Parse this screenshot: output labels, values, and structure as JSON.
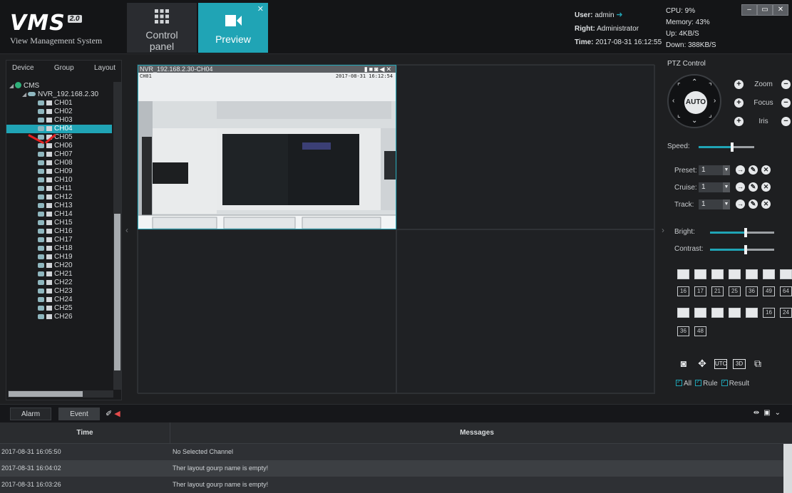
{
  "app": {
    "logo_text": "VMS",
    "version_badge": "2.0",
    "subtitle": "View Management System"
  },
  "nav_tabs": [
    {
      "label": "Control\npanel"
    },
    {
      "label": "Preview"
    }
  ],
  "user_info": {
    "user_label": "User:",
    "user_value": "admin",
    "right_label": "Right:",
    "right_value": "Administrator",
    "time_label": "Time:",
    "time_value": "2017-08-31 16:12:55"
  },
  "system_info": {
    "cpu": "CPU: 9%",
    "memory": "Memory: 43%",
    "up": "Up: 4KB/S",
    "down": "Down: 388KB/S"
  },
  "left_panel": {
    "tabs": [
      "Device",
      "Group",
      "Layout"
    ],
    "tree_root": "CMS",
    "device": "NVR_192.168.2.30",
    "channels": [
      "CH01",
      "CH02",
      "CH03",
      "CH04",
      "CH05",
      "CH06",
      "CH07",
      "CH08",
      "CH09",
      "CH10",
      "CH11",
      "CH12",
      "CH13",
      "CH14",
      "CH15",
      "CH16",
      "CH17",
      "CH18",
      "CH19",
      "CH20",
      "CH21",
      "CH22",
      "CH23",
      "CH24",
      "CH25",
      "CH26"
    ],
    "selected_channel": "CH04"
  },
  "preview": {
    "active_title": "NVR_192.168.2.30-CH04",
    "osd_channel": "CH01",
    "osd_time": "2017-08-31 16:12:54"
  },
  "ptz": {
    "title": "PTZ Control",
    "auto_label": "AUTO",
    "zoom_label": "Zoom",
    "focus_label": "Focus",
    "iris_label": "Iris",
    "speed_label": "Speed:",
    "speed_level": 0.6,
    "preset_label": "Preset:",
    "preset_value": "1",
    "cruise_label": "Cruise:",
    "cruise_value": "1",
    "track_label": "Track:",
    "track_value": "1",
    "bright_label": "Bright:",
    "bright_level": 0.55,
    "contrast_label": "Contrast:",
    "contrast_level": 0.55,
    "layout_row2": [
      "16",
      "17",
      "21",
      "25",
      "36",
      "49",
      "64"
    ],
    "layout_row3_labels": [
      "16",
      "24"
    ],
    "layout_row4": [
      "36",
      "48"
    ],
    "tool_text": [
      "UTC",
      "3D"
    ],
    "checks": [
      "All",
      "Rule",
      "Result"
    ]
  },
  "bottom": {
    "tabs": [
      "Alarm",
      "Event"
    ],
    "columns": [
      "Time",
      "Messages"
    ],
    "rows": [
      {
        "time": "2017-08-31 16:05:50",
        "message": "No Selected Channel"
      },
      {
        "time": "2017-08-31 16:04:02",
        "message": "Ther layout gourp name is empty!"
      },
      {
        "time": "2017-08-31 16:03:26",
        "message": "Ther layout gourp name is empty!"
      }
    ]
  },
  "colors": {
    "accent": "#20a4b5",
    "annotation": "#e32222"
  }
}
